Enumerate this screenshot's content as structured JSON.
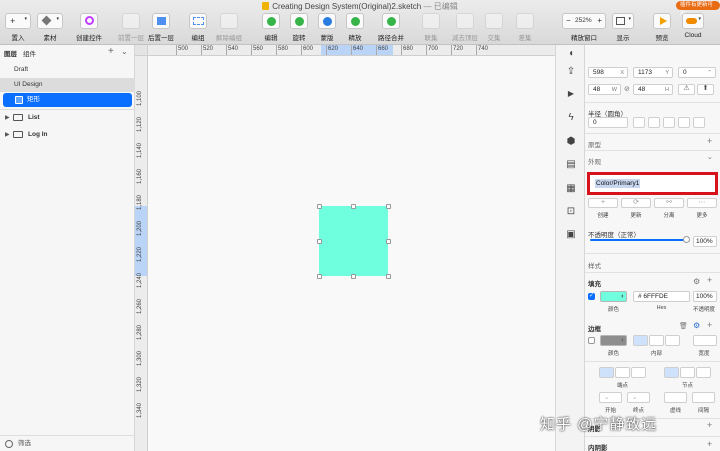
{
  "window": {
    "title": "Creating Design System(Original)2.sketch",
    "status": "— 已编辑"
  },
  "badge": "插件有更新可用",
  "toolbar": {
    "insert": "置入",
    "symbols": "素材",
    "create_symbol": "创建控件",
    "forward": "前置一层",
    "backward": "后置一层",
    "group": "编组",
    "ungroup": "解除编组",
    "edit": "编辑",
    "rotate": "旋转",
    "mask": "蒙版",
    "scale": "精放",
    "flatten": "路径合并",
    "union": "联集",
    "subtract": "减去顶层",
    "intersect": "交集",
    "difference": "差集",
    "zoom": "252%",
    "zoom_label": "精放窗口",
    "view": "显示",
    "preview": "预览",
    "cloud": "Cloud"
  },
  "sidebar": {
    "tab_layers": "图层",
    "tab_components": "组件",
    "pages": [
      "Draft",
      "UI Design"
    ],
    "selected_layer": "矩形",
    "artboards": [
      "List",
      "Log In"
    ],
    "filter": "筛选"
  },
  "ruler": {
    "top": [
      "500",
      "520",
      "540",
      "560",
      "580",
      "600",
      "620",
      "640",
      "660",
      "680",
      "700",
      "720",
      "740"
    ],
    "left": [
      "1,100",
      "1,120",
      "1,140",
      "1,160",
      "1,180",
      "1,200",
      "1,220",
      "1,240",
      "1,260",
      "1,280",
      "1,300",
      "1,320",
      "1,340"
    ]
  },
  "rect": {
    "fill": "#6FFFDE"
  },
  "inspector": {
    "x": "598",
    "x_label": "X",
    "y": "1173",
    "y_label": "Y",
    "rotation": "0",
    "w": "48",
    "w_label": "W",
    "h": "48",
    "h_label": "H",
    "radius_label": "半径（圆角）",
    "radius": "0",
    "type_label": "原型",
    "appearance_label": "外观",
    "style_name": "Color/Primary1",
    "style_actions": [
      "创建",
      "更新",
      "分离",
      "更多"
    ],
    "opacity_label": "不透明度（正常）",
    "opacity": "100%",
    "style_label": "样式",
    "fill_label": "填充",
    "fill_hex": "# 6FFFDE",
    "fill_opacity": "100%",
    "fill_sub": [
      "颜色",
      "Hex",
      "不透明度"
    ],
    "border_label": "边框",
    "border_sub": [
      "颜色",
      "内部",
      "宽度"
    ],
    "endpoint_label": "端点",
    "node_label": "节点",
    "line_sub": [
      "开始",
      "终点",
      "虚线",
      "间隔"
    ],
    "shadow_label": "阴影",
    "inner_shadow_label": "内阴影"
  },
  "watermark": "知乎 @宁静致远"
}
